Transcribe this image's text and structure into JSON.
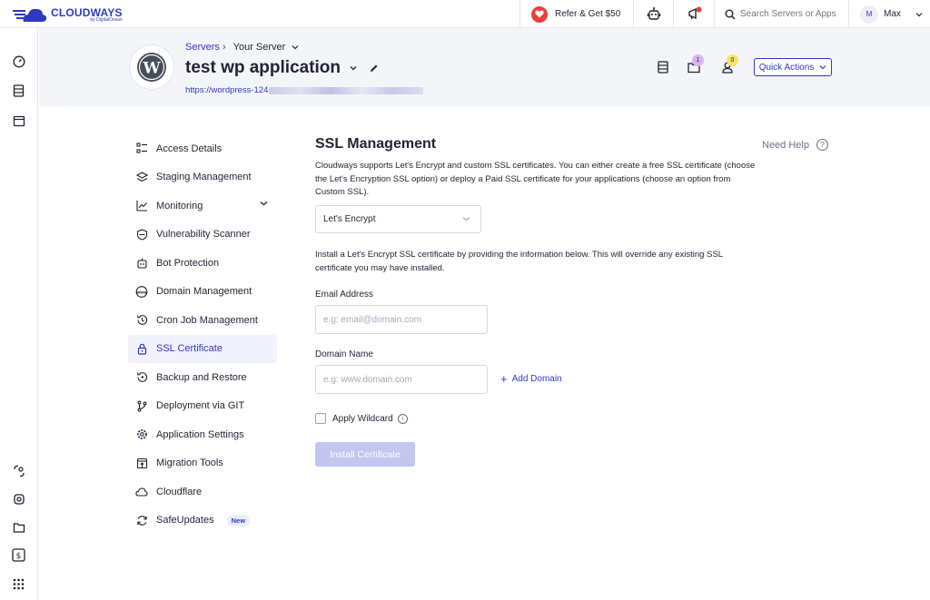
{
  "topbar": {
    "brand": "CLOUDWAYS",
    "brand_sub": "by DigitalOcean",
    "refer_label": "Refer & Get $50",
    "search_placeholder": "Search Servers or Apps",
    "user_initial": "M",
    "user_name": "Max"
  },
  "header": {
    "breadcrumb_servers": "Servers ›",
    "breadcrumb_server": "Your Server",
    "app_name": "test wp application",
    "app_url": "https://wordpress-124",
    "folder_badge": "1",
    "users_badge": "0",
    "quick_actions_label": "Quick Actions"
  },
  "menu": {
    "items": [
      {
        "label": "Access Details",
        "icon": "access-details-icon"
      },
      {
        "label": "Staging Management",
        "icon": "layers-icon"
      },
      {
        "label": "Monitoring",
        "icon": "chart-line-icon"
      },
      {
        "label": "Vulnerability Scanner",
        "icon": "shield-scan-icon"
      },
      {
        "label": "Bot Protection",
        "icon": "robot-icon"
      },
      {
        "label": "Domain Management",
        "icon": "www-icon"
      },
      {
        "label": "Cron Job Management",
        "icon": "history-icon"
      },
      {
        "label": "SSL Certificate",
        "icon": "lock-icon"
      },
      {
        "label": "Backup and Restore",
        "icon": "backup-icon"
      },
      {
        "label": "Deployment via GIT",
        "icon": "git-branch-icon"
      },
      {
        "label": "Application Settings",
        "icon": "gear-icon"
      },
      {
        "label": "Migration Tools",
        "icon": "migration-icon"
      },
      {
        "label": "Cloudflare",
        "icon": "cloud-icon"
      },
      {
        "label": "SafeUpdates",
        "icon": "refresh-icon",
        "badge": "New"
      }
    ],
    "active": "SSL Certificate"
  },
  "main": {
    "title": "SSL Management",
    "need_help": "Need Help",
    "description": "Cloudways supports Let's Encrypt and custom SSL certificates. You can either create a free SSL certificate (choose the Let's Encryption SSL option) or deploy a Paid SSL certificate for your applications (choose an option from Custom SSL).",
    "certificate_type": "Let's Encrypt",
    "instructions": "Install a Let's Encrypt SSL certificate by providing the information below. This will override any existing SSL certificate you may have installed.",
    "email_label": "Email Address",
    "email_placeholder": "e.g: email@domain.com",
    "domain_label": "Domain Name",
    "domain_placeholder": "e.g: www.domain.com",
    "add_domain_label": "Add Domain",
    "wildcard_label": "Apply Wildcard",
    "install_button": "Install Certificate"
  },
  "colors": {
    "brand": "#2f39bf",
    "heart": "#e8413b",
    "notification_dot": "#e8413b",
    "folder_badge": "#d9b5f0",
    "users_badge": "#f5e46a",
    "install_disabled": "#c3c6ee"
  }
}
